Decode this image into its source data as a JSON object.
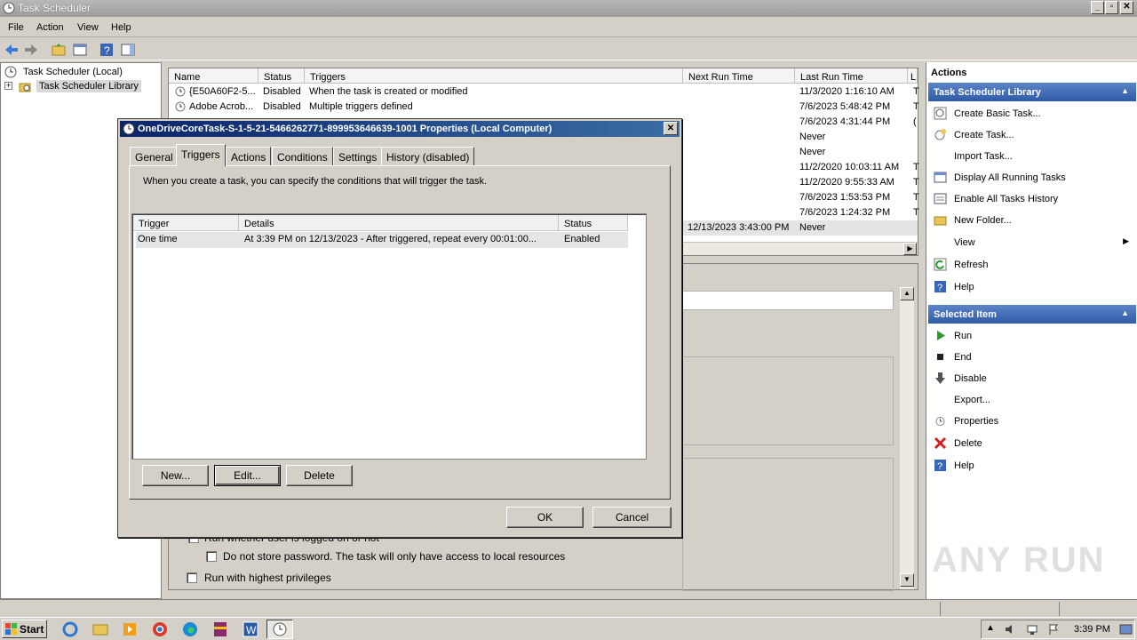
{
  "window": {
    "title": "Task Scheduler",
    "min": "_",
    "max": "▫",
    "close": "✕"
  },
  "menu": {
    "file": "File",
    "action": "Action",
    "view": "View",
    "help": "Help"
  },
  "tree": {
    "root": "Task Scheduler (Local)",
    "library": "Task Scheduler Library",
    "expander": "+"
  },
  "tasklist": {
    "headers": {
      "name": "Name",
      "status": "Status",
      "triggers": "Triggers",
      "next": "Next Run Time",
      "last": "Last Run Time",
      "extra": "L"
    },
    "rows": [
      {
        "name": "{E50A60F2-5...",
        "status": "Disabled",
        "triggers": "When the task is created or modified",
        "next": "",
        "last": "11/3/2020 1:16:10 AM",
        "extra": "T"
      },
      {
        "name": "Adobe Acrob...",
        "status": "Disabled",
        "triggers": "Multiple triggers defined",
        "next": "",
        "last": "7/6/2023 5:48:42 PM",
        "extra": "T"
      },
      {
        "name": "",
        "status": "",
        "triggers": "",
        "next": "",
        "last": "7/6/2023 4:31:44 PM",
        "extra": "("
      },
      {
        "name": "",
        "status": "",
        "triggers": "",
        "next": "",
        "last": "Never",
        "extra": ""
      },
      {
        "name": "",
        "status": "",
        "triggers": "",
        "next": "",
        "last": "Never",
        "extra": ""
      },
      {
        "name": "",
        "status": "",
        "triggers": "",
        "next": "",
        "last": "11/2/2020 10:03:11 AM",
        "extra": "T"
      },
      {
        "name": "",
        "status": "",
        "triggers": "",
        "next": "",
        "last": "11/2/2020 9:55:33 AM",
        "extra": "T"
      },
      {
        "name": "",
        "status": "",
        "triggers": "",
        "next": "",
        "last": "7/6/2023 1:53:53 PM",
        "extra": "T"
      },
      {
        "name": "",
        "status": "",
        "triggers": "",
        "next": "",
        "last": "7/6/2023 1:24:32 PM",
        "extra": "T"
      },
      {
        "name": "",
        "status": "",
        "triggers": "",
        "next": "12/13/2023 3:43:00 PM",
        "last": "Never",
        "extra": ""
      }
    ]
  },
  "detail": {
    "run_logged": "Run whether user is logged on or not",
    "no_store_pw": "Do not store password.  The task will only have access to local resources",
    "highest": "Run with highest privileges"
  },
  "actions": {
    "header": "Actions",
    "library_section": "Task Scheduler Library",
    "library_items": [
      "Create Basic Task...",
      "Create Task...",
      "Import Task...",
      "Display All Running Tasks",
      "Enable All Tasks History",
      "New Folder...",
      "View",
      "Refresh",
      "Help"
    ],
    "selected_section": "Selected Item",
    "selected_items": [
      "Run",
      "End",
      "Disable",
      "Export...",
      "Properties",
      "Delete",
      "Help"
    ]
  },
  "dialog": {
    "title": "OneDriveCoreTask-S-1-5-21-5466262771-899953646639-1001 Properties (Local Computer)",
    "close": "✕",
    "tabs": [
      "General",
      "Triggers",
      "Actions",
      "Conditions",
      "Settings",
      "History (disabled)"
    ],
    "description": "When you create a task, you can specify the conditions that will trigger the task.",
    "table_headers": {
      "trigger": "Trigger",
      "details": "Details",
      "status": "Status"
    },
    "rows": [
      {
        "trigger": "One time",
        "details": "At 3:39 PM on 12/13/2023 - After triggered, repeat every 00:01:00...",
        "status": "Enabled"
      }
    ],
    "buttons": {
      "new": "New...",
      "edit": "Edit...",
      "delete": "Delete",
      "ok": "OK",
      "cancel": "Cancel"
    }
  },
  "taskbar": {
    "start": "Start",
    "clock": "3:39 PM"
  },
  "watermark": "ANY RUN",
  "colors": {
    "accent": "#2f5aa6",
    "dialog_title": "#0a246a"
  }
}
